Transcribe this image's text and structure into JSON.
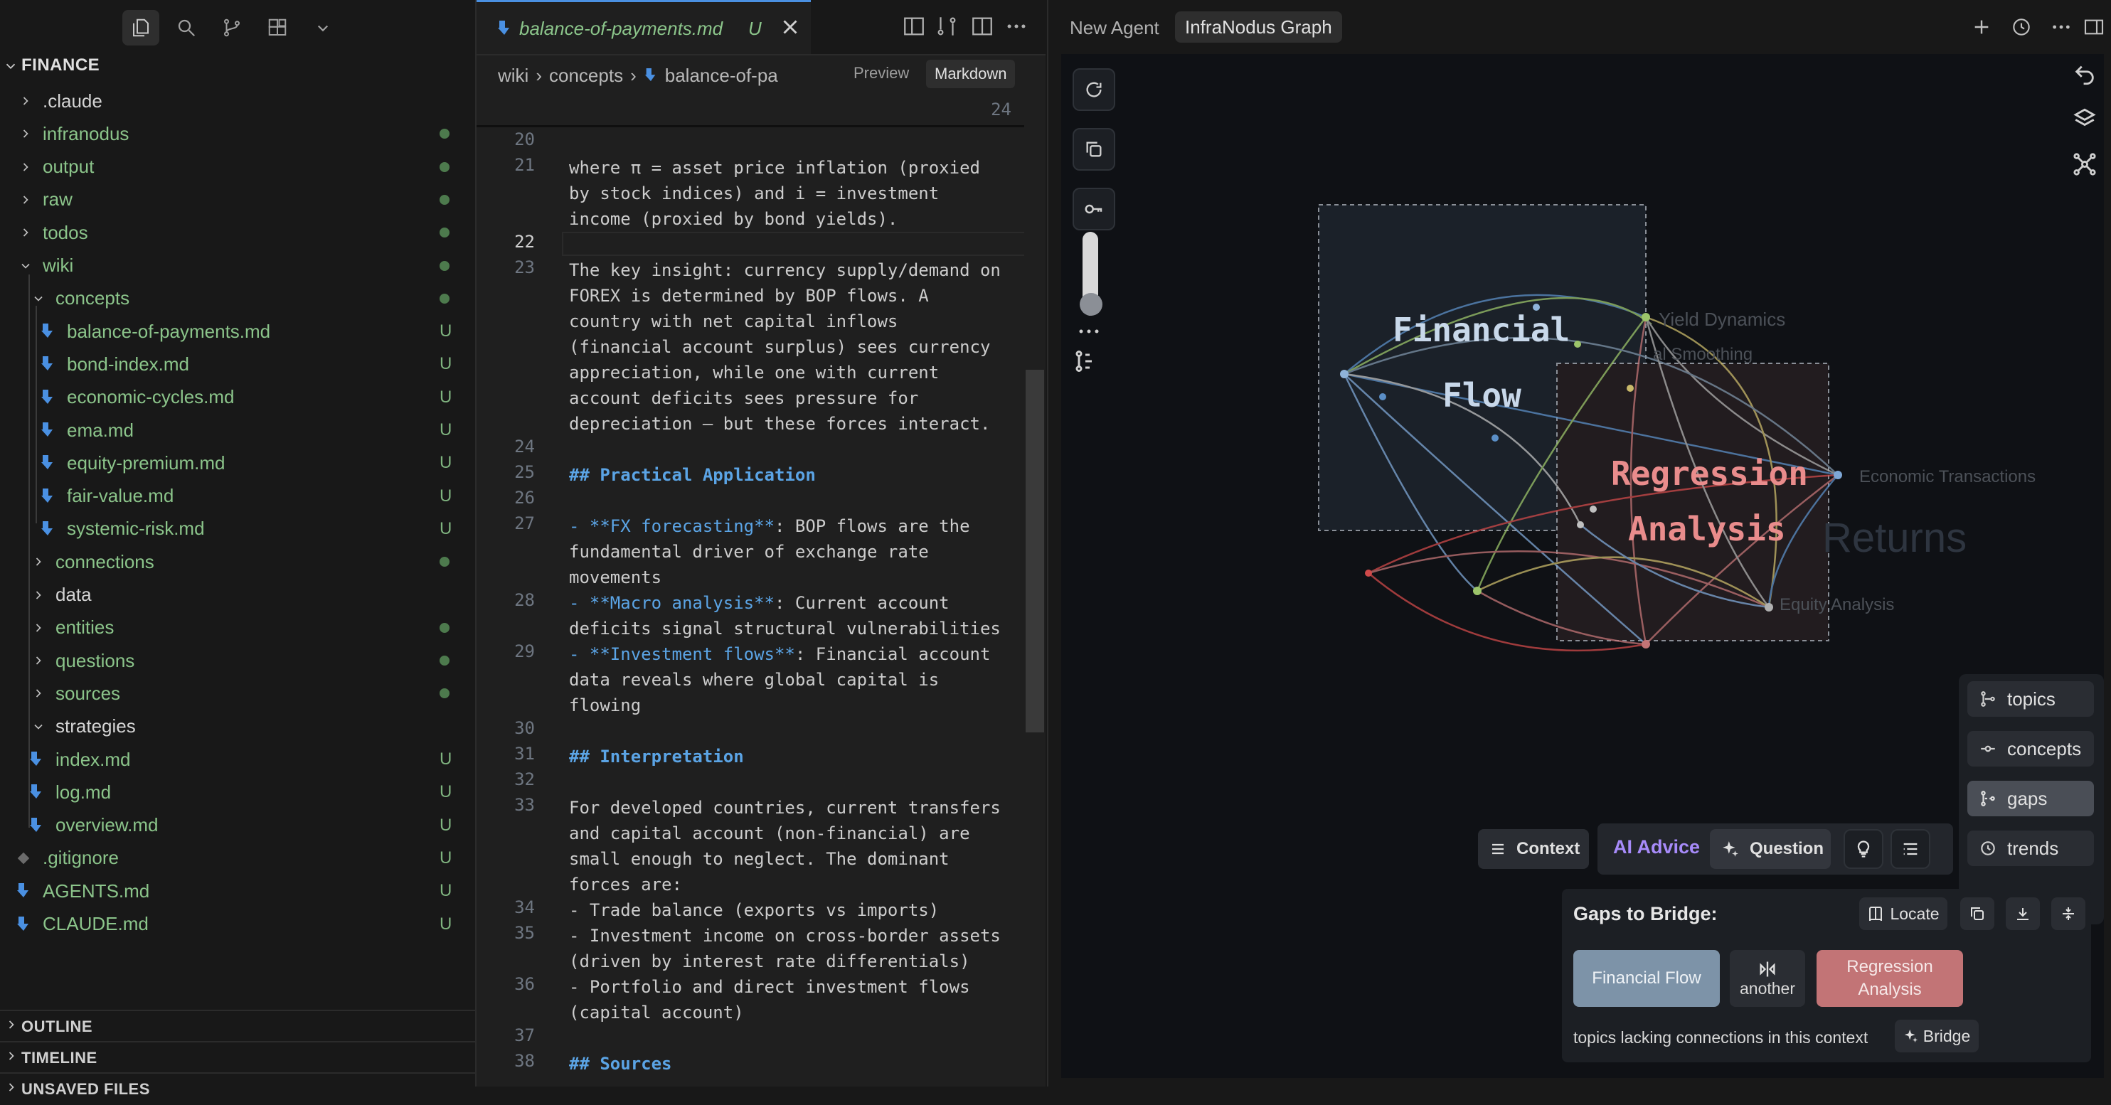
{
  "sidebar": {
    "root_label": "FINANCE",
    "items": [
      {
        "label": ".claude",
        "status": ""
      },
      {
        "label": "infranodus",
        "status": "dot"
      },
      {
        "label": "output",
        "status": "dot"
      },
      {
        "label": "raw",
        "status": "dot"
      },
      {
        "label": "todos",
        "status": "dot"
      },
      {
        "label": "wiki",
        "status": "dot"
      },
      {
        "label": "concepts",
        "status": "dot"
      },
      {
        "label": "balance-of-payments.md",
        "status": "U"
      },
      {
        "label": "bond-index.md",
        "status": "U"
      },
      {
        "label": "economic-cycles.md",
        "status": "U"
      },
      {
        "label": "ema.md",
        "status": "U"
      },
      {
        "label": "equity-premium.md",
        "status": "U"
      },
      {
        "label": "fair-value.md",
        "status": "U"
      },
      {
        "label": "systemic-risk.md",
        "status": "U"
      },
      {
        "label": "connections",
        "status": "dot"
      },
      {
        "label": "data",
        "status": ""
      },
      {
        "label": "entities",
        "status": "dot"
      },
      {
        "label": "questions",
        "status": "dot"
      },
      {
        "label": "sources",
        "status": "dot"
      },
      {
        "label": "strategies",
        "status": ""
      },
      {
        "label": "index.md",
        "status": "U"
      },
      {
        "label": "log.md",
        "status": "U"
      },
      {
        "label": "overview.md",
        "status": "U"
      },
      {
        "label": ".gitignore",
        "status": "U"
      },
      {
        "label": "AGENTS.md",
        "status": "U"
      },
      {
        "label": "CLAUDE.md",
        "status": "U"
      }
    ],
    "sections": [
      "OUTLINE",
      "TIMELINE",
      "UNSAVED FILES"
    ]
  },
  "editor": {
    "tab_label": "balance-of-payments.md",
    "tab_status": "U",
    "breadcrumb": [
      "wiki",
      "concepts",
      "balance-of-pa"
    ],
    "preview_label": "Preview",
    "markdown_label": "Markdown",
    "sticky_line_number": "24",
    "lines": [
      {
        "n": "20",
        "segs": [
          {
            "t": "",
            "c": ""
          }
        ]
      },
      {
        "n": "21",
        "segs": [
          {
            "t": "where π = asset price inflation (proxied",
            "c": ""
          }
        ]
      },
      {
        "n": "",
        "segs": [
          {
            "t": "by stock indices) and i = investment",
            "c": ""
          }
        ]
      },
      {
        "n": "",
        "segs": [
          {
            "t": "income (proxied by bond yields).",
            "c": ""
          }
        ]
      },
      {
        "n": "22",
        "segs": [
          {
            "t": "",
            "c": ""
          }
        ],
        "current": true
      },
      {
        "n": "23",
        "segs": [
          {
            "t": "The key insight: currency supply/demand on",
            "c": ""
          }
        ]
      },
      {
        "n": "",
        "segs": [
          {
            "t": "FOREX is determined by BOP flows. A",
            "c": ""
          }
        ]
      },
      {
        "n": "",
        "segs": [
          {
            "t": "country with net capital inflows",
            "c": ""
          }
        ]
      },
      {
        "n": "",
        "segs": [
          {
            "t": "(financial account surplus) sees currency",
            "c": ""
          }
        ]
      },
      {
        "n": "",
        "segs": [
          {
            "t": "appreciation, while one with current",
            "c": ""
          }
        ]
      },
      {
        "n": "",
        "segs": [
          {
            "t": "account deficits sees pressure for",
            "c": ""
          }
        ]
      },
      {
        "n": "",
        "segs": [
          {
            "t": "depreciation — but these forces interact.",
            "c": ""
          }
        ]
      },
      {
        "n": "24",
        "segs": [
          {
            "t": "",
            "c": ""
          }
        ]
      },
      {
        "n": "25",
        "segs": [
          {
            "t": "## Practical Application",
            "c": "hd"
          }
        ]
      },
      {
        "n": "26",
        "segs": [
          {
            "t": "",
            "c": ""
          }
        ]
      },
      {
        "n": "27",
        "segs": [
          {
            "t": "- **FX forecasting**",
            "c": "bold-mk"
          },
          {
            "t": ": BOP flows are the",
            "c": ""
          }
        ]
      },
      {
        "n": "",
        "segs": [
          {
            "t": "fundamental driver of exchange rate",
            "c": ""
          }
        ]
      },
      {
        "n": "",
        "segs": [
          {
            "t": "movements",
            "c": ""
          }
        ]
      },
      {
        "n": "28",
        "segs": [
          {
            "t": "- **Macro analysis**",
            "c": "bold-mk"
          },
          {
            "t": ": Current account",
            "c": ""
          }
        ]
      },
      {
        "n": "",
        "segs": [
          {
            "t": "deficits signal structural vulnerabilities",
            "c": ""
          }
        ]
      },
      {
        "n": "29",
        "segs": [
          {
            "t": "- **Investment flows**",
            "c": "bold-mk"
          },
          {
            "t": ": Financial account",
            "c": ""
          }
        ]
      },
      {
        "n": "",
        "segs": [
          {
            "t": "data reveals where global capital is",
            "c": ""
          }
        ]
      },
      {
        "n": "",
        "segs": [
          {
            "t": "flowing",
            "c": ""
          }
        ]
      },
      {
        "n": "30",
        "segs": [
          {
            "t": "",
            "c": ""
          }
        ]
      },
      {
        "n": "31",
        "segs": [
          {
            "t": "## Interpretation",
            "c": "hd"
          }
        ]
      },
      {
        "n": "32",
        "segs": [
          {
            "t": "",
            "c": ""
          }
        ]
      },
      {
        "n": "33",
        "segs": [
          {
            "t": "For developed countries, current transfers",
            "c": ""
          }
        ]
      },
      {
        "n": "",
        "segs": [
          {
            "t": "and capital account (non-financial) are",
            "c": ""
          }
        ]
      },
      {
        "n": "",
        "segs": [
          {
            "t": "small enough to neglect. The dominant",
            "c": ""
          }
        ]
      },
      {
        "n": "",
        "segs": [
          {
            "t": "forces are:",
            "c": ""
          }
        ]
      },
      {
        "n": "34",
        "segs": [
          {
            "t": "- Trade balance (exports vs imports)",
            "c": ""
          }
        ]
      },
      {
        "n": "35",
        "segs": [
          {
            "t": "- Investment income on cross-border assets",
            "c": ""
          }
        ]
      },
      {
        "n": "",
        "segs": [
          {
            "t": "(driven by interest rate differentials)",
            "c": ""
          }
        ]
      },
      {
        "n": "36",
        "segs": [
          {
            "t": "- Portfolio and direct investment flows",
            "c": ""
          }
        ]
      },
      {
        "n": "",
        "segs": [
          {
            "t": "(capital account)",
            "c": ""
          }
        ]
      },
      {
        "n": "37",
        "segs": [
          {
            "t": "",
            "c": ""
          }
        ]
      },
      {
        "n": "38",
        "segs": [
          {
            "t": "## Sources",
            "c": "hd"
          }
        ]
      }
    ]
  },
  "panel": {
    "new_agent_label": "New Agent",
    "graph_tab_label": "InfraNodus Graph",
    "graph": {
      "topic_labels": {
        "financial_1": "Financial",
        "financial_2": "Flow",
        "regression_1": "Regression",
        "regression_2": "Analysis"
      },
      "faint_labels": {
        "yield": "Yield Dynamics",
        "smoothing": "al Smoothing",
        "economic": "Economic Transactions",
        "returns": "Returns",
        "equity": "Equity Analysis"
      }
    },
    "view_buttons": [
      "topics",
      "concepts",
      "gaps",
      "trends"
    ],
    "active_view": "gaps",
    "context_label": "Context",
    "ai_advice_label": "AI Advice",
    "question_label": "Question",
    "gaps": {
      "title": "Gaps to Bridge:",
      "locate_label": "Locate",
      "topic_a": "Financial Flow",
      "another_label": "another",
      "topic_b": "Regression Analysis",
      "note": "topics lacking connections in this context",
      "bridge_label": "Bridge"
    },
    "colors": {
      "financial_flow": "#7d93a8",
      "regression_analysis": "#c27476",
      "ai_advice": "#a78bfa"
    }
  }
}
